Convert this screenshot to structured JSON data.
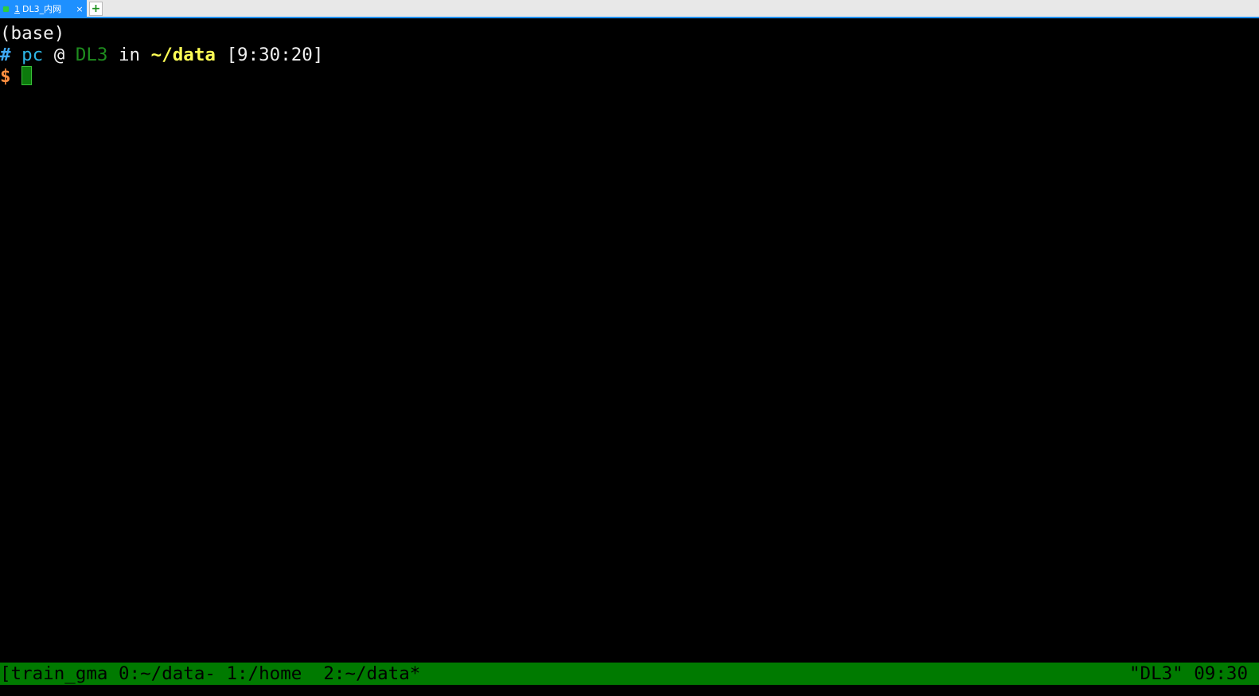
{
  "tabbar": {
    "tabs": [
      {
        "index": "1",
        "label": " DL3_内网",
        "close": "×",
        "status_color": "#2ecc40"
      }
    ],
    "new_tab": "+"
  },
  "terminal": {
    "line1": "(base)",
    "prompt": {
      "hash": "#",
      "user": "pc",
      "at": "@",
      "host": "DL3",
      "in": "in",
      "path": "~/data",
      "time": "[9:30:20]",
      "dollar": "$"
    }
  },
  "statusbar": {
    "left": "[train_gma 0:~/data- 1:/home  2:~/data*",
    "right": "\"DL3\" 09:30",
    "color": "#007a00"
  }
}
